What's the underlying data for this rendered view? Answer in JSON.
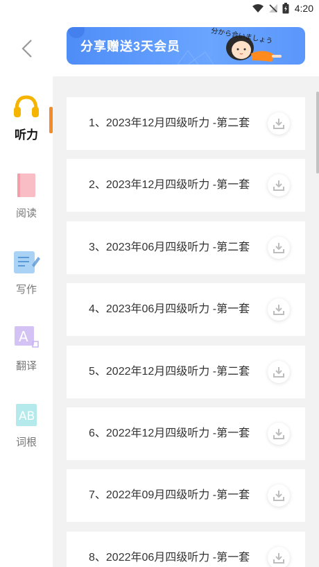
{
  "status_bar": {
    "time": "4:20"
  },
  "banner": {
    "text": "分享赠送3天会员",
    "decor_text": "分から合いましょう"
  },
  "sidebar": {
    "items": [
      {
        "label": "听力",
        "icon": "headphones-icon",
        "active": true
      },
      {
        "label": "阅读",
        "icon": "book-icon",
        "active": false
      },
      {
        "label": "写作",
        "icon": "notepad-pen-icon",
        "active": false
      },
      {
        "label": "翻译",
        "icon": "translate-icon",
        "active": false
      },
      {
        "label": "词根",
        "icon": "ab-root-icon",
        "active": false
      }
    ]
  },
  "list": {
    "items": [
      {
        "label": "1、2023年12月四级听力 -第二套"
      },
      {
        "label": "2、2023年12月四级听力 -第一套"
      },
      {
        "label": "3、2023年06月四级听力 -第二套"
      },
      {
        "label": "4、2023年06月四级听力 -第一套"
      },
      {
        "label": "5、2022年12月四级听力 -第二套"
      },
      {
        "label": "6、2022年12月四级听力 -第一套"
      },
      {
        "label": "7、2022年09月四级听力 -第一套"
      },
      {
        "label": "8、2022年06月四级听力 -第一套"
      }
    ]
  },
  "colors": {
    "accent": "#f28c28",
    "banner": "#5b97fb",
    "background": "#f2f2f2"
  }
}
